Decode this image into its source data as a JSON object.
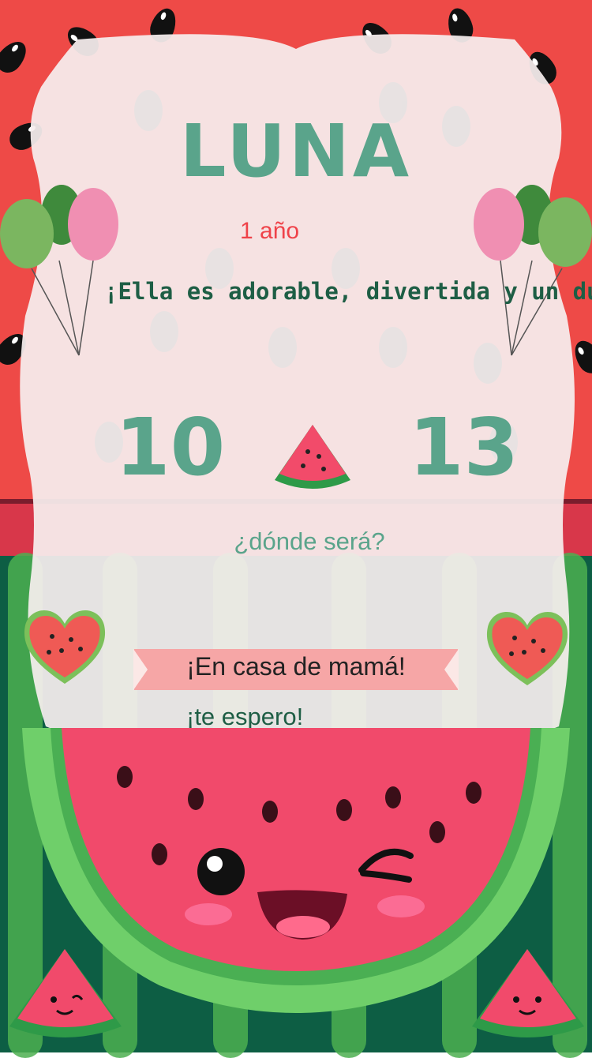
{
  "invitation": {
    "name": "LUNA",
    "age": "1 año",
    "tagline": "¡Ella es adorable, divertida y un dulce",
    "date_day": "10",
    "date_month": "13",
    "where_label": "¿dónde será?",
    "place": "¡En casa de mamá!",
    "closing": "¡te espero!"
  },
  "colors": {
    "accent_green": "#5aa48b",
    "accent_red": "#ef4249",
    "dark_green": "#1e5e45",
    "ribbon": "#f6a6a6"
  },
  "icons": [
    "balloon-icon",
    "watermelon-slice-icon",
    "watermelon-heart-icon",
    "watermelon-face-icon"
  ]
}
